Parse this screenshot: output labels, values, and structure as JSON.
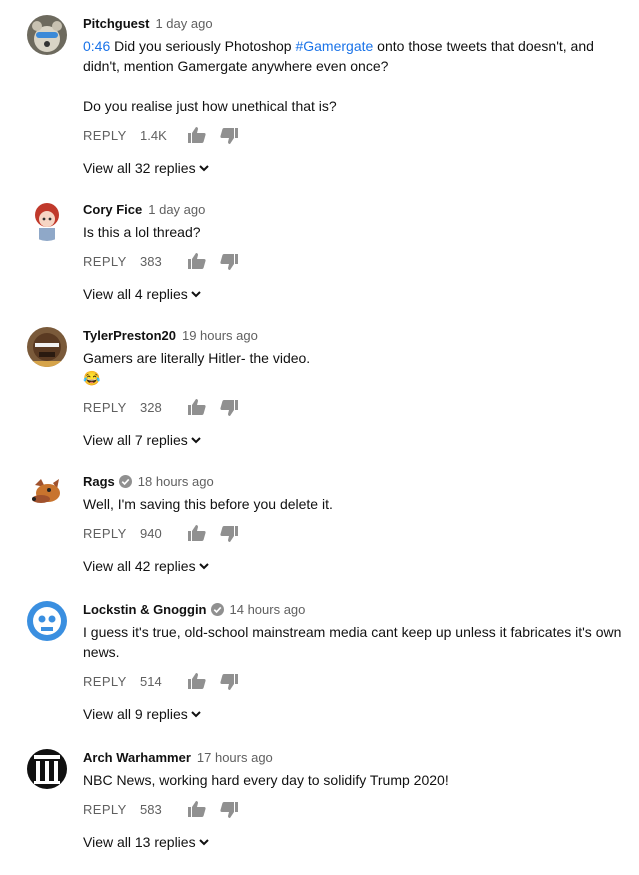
{
  "comments": [
    {
      "author": "Pitchguest",
      "verified": false,
      "time": "1 day ago",
      "timestamp_link": "0:46",
      "text_pre": " Did you seriously Photoshop ",
      "hashtag": "#Gamergate",
      "text_post": " onto those tweets that doesn't, and didn't, mention Gamergate anywhere even once?\n\nDo you realise just how unethical that is?",
      "reply_label": "REPLY",
      "likes": "1.4K",
      "view_replies": "View all 32 replies"
    },
    {
      "author": "Cory Fice",
      "verified": false,
      "time": "1 day ago",
      "text": "Is this a lol thread?",
      "reply_label": "REPLY",
      "likes": "383",
      "view_replies": "View all 4 replies"
    },
    {
      "author": "TylerPreston20",
      "verified": false,
      "time": "19 hours ago",
      "text": "Gamers are literally Hitler- the video.\n😂",
      "reply_label": "REPLY",
      "likes": "328",
      "view_replies": "View all 7 replies"
    },
    {
      "author": "Rags",
      "verified": true,
      "time": "18 hours ago",
      "text": "Well, I'm saving this before you delete it.",
      "reply_label": "REPLY",
      "likes": "940",
      "view_replies": "View all 42 replies"
    },
    {
      "author": "Lockstin & Gnoggin",
      "verified": true,
      "time": "14 hours ago",
      "text": "I guess it's true, old-school mainstream media cant keep up unless it fabricates it's own news.",
      "reply_label": "REPLY",
      "likes": "514",
      "view_replies": "View all 9 replies"
    },
    {
      "author": "Arch Warhammer",
      "verified": false,
      "time": "17 hours ago",
      "text": "NBC News, working hard every day to solidify Trump 2020!",
      "reply_label": "REPLY",
      "likes": "583",
      "view_replies": "View all 13 replies"
    }
  ],
  "colors": {
    "link": "#1a73e8",
    "meta": "#606060",
    "text": "#111111"
  }
}
